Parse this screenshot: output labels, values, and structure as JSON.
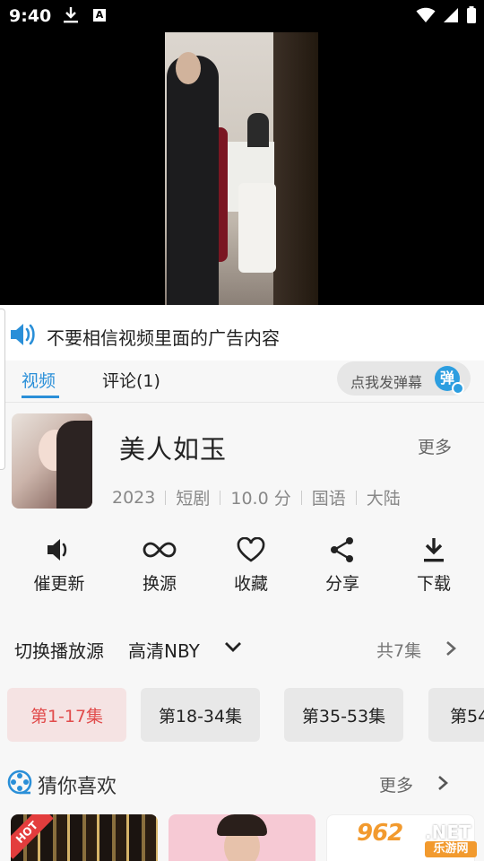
{
  "status_bar": {
    "time": "9:40",
    "a_badge": "A"
  },
  "notice": {
    "text": "不要相信视频里面的广告内容"
  },
  "tabs": [
    {
      "label": "视频",
      "active": true
    },
    {
      "label": "评论(1)",
      "active": false
    }
  ],
  "danmu": {
    "placeholder": "点我发弹幕",
    "icon_label": "弹"
  },
  "video": {
    "title": "美人如玉",
    "more_label": "更多",
    "meta": [
      "2023",
      "短剧",
      "10.0 分",
      "国语",
      "大陆"
    ]
  },
  "actions": [
    {
      "label": "催更新",
      "icon": "speaker-icon"
    },
    {
      "label": "换源",
      "icon": "infinity-icon"
    },
    {
      "label": "收藏",
      "icon": "heart-icon"
    },
    {
      "label": "分享",
      "icon": "share-icon"
    },
    {
      "label": "下载",
      "icon": "download-icon"
    }
  ],
  "source": {
    "label": "切换播放源",
    "name": "高清NBY",
    "episode_count": "共7集"
  },
  "episodes": [
    {
      "label": "第1-17集",
      "active": true
    },
    {
      "label": "第18-34集",
      "active": false
    },
    {
      "label": "第35-53集",
      "active": false
    },
    {
      "label": "第54",
      "active": false
    }
  ],
  "recommend": {
    "title": "猜你喜欢",
    "more_label": "更多",
    "hot_badge": "HOT"
  },
  "watermark": {
    "number": "962",
    "net": ".NET",
    "cn": "乐游网"
  },
  "colors": {
    "accent_blue": "#2a8fd8",
    "episode_active": "#e14b4b",
    "logo_orange": "#f29a2e"
  }
}
